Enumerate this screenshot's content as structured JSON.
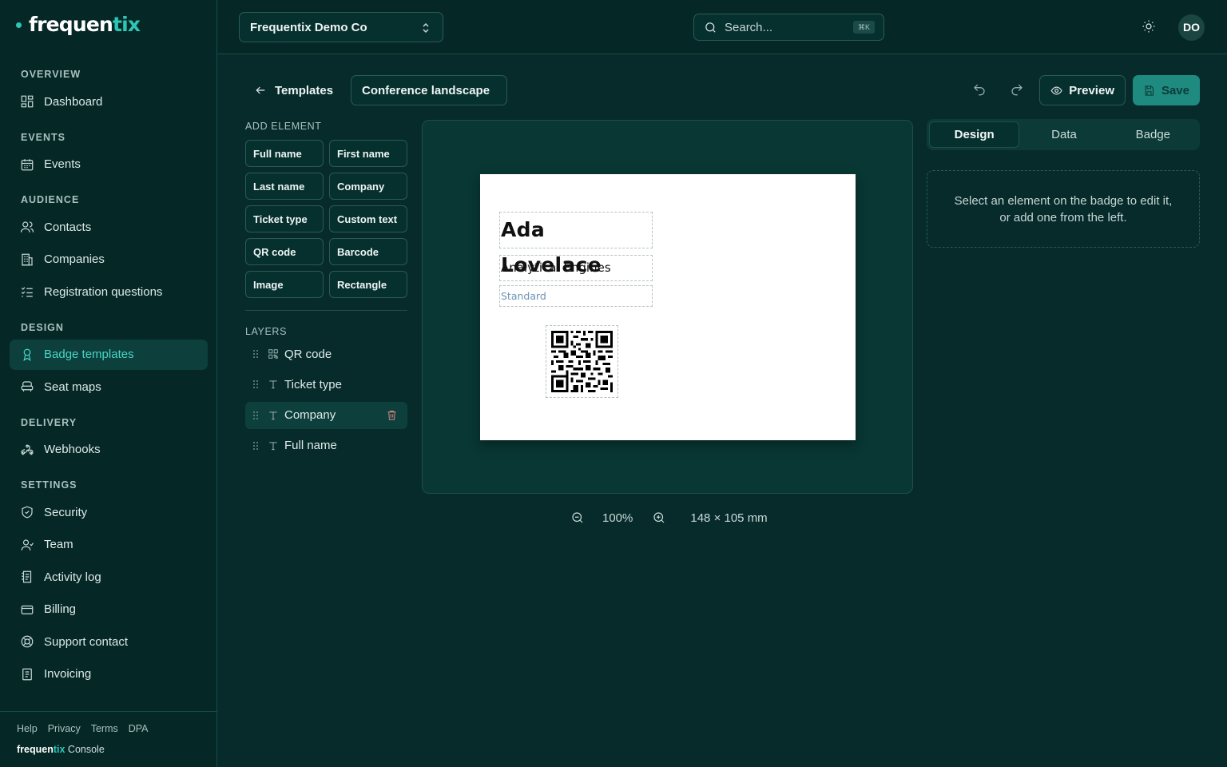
{
  "brand": {
    "name_main": "frequen",
    "name_accent": "tix",
    "accent_color": "#2cc6b5"
  },
  "sidebar": {
    "sections": [
      {
        "title": "OVERVIEW",
        "items": [
          {
            "label": "Dashboard",
            "icon": "dashboard-icon"
          }
        ]
      },
      {
        "title": "EVENTS",
        "items": [
          {
            "label": "Events",
            "icon": "calendar-icon"
          }
        ]
      },
      {
        "title": "AUDIENCE",
        "items": [
          {
            "label": "Contacts",
            "icon": "users-icon"
          },
          {
            "label": "Companies",
            "icon": "building-icon"
          },
          {
            "label": "Registration questions",
            "icon": "list-check-icon"
          }
        ]
      },
      {
        "title": "DESIGN",
        "items": [
          {
            "label": "Badge templates",
            "icon": "badge-icon",
            "active": true
          },
          {
            "label": "Seat maps",
            "icon": "seat-icon"
          }
        ]
      },
      {
        "title": "DELIVERY",
        "items": [
          {
            "label": "Webhooks",
            "icon": "webhook-icon"
          }
        ]
      },
      {
        "title": "SETTINGS",
        "items": [
          {
            "label": "Security",
            "icon": "shield-icon"
          },
          {
            "label": "Team",
            "icon": "team-icon"
          },
          {
            "label": "Activity log",
            "icon": "activity-log-icon"
          },
          {
            "label": "Billing",
            "icon": "credit-card-icon"
          },
          {
            "label": "Support contact",
            "icon": "lifebuoy-icon"
          },
          {
            "label": "Invoicing",
            "icon": "invoice-icon"
          }
        ]
      }
    ],
    "footer_links": [
      "Help",
      "Privacy",
      "Terms",
      "DPA"
    ],
    "footer_brand": {
      "main": "frequen",
      "accent": "tix",
      "suffix": "Console"
    }
  },
  "topbar": {
    "org": "Frequentix Demo Co",
    "search_placeholder": "Search...",
    "shortcut": "⌘K",
    "avatar_initials": "DO"
  },
  "editor": {
    "back_label": "Templates",
    "template_name": "Conference landscape",
    "preview_label": "Preview",
    "save_label": "Save",
    "add_element_title": "ADD ELEMENT",
    "elements": [
      "Full name",
      "First name",
      "Last name",
      "Company",
      "Ticket type",
      "Custom text",
      "QR code",
      "Barcode",
      "Image",
      "Rectangle"
    ],
    "layers_title": "LAYERS",
    "layers": [
      {
        "label": "QR code",
        "type": "qr"
      },
      {
        "label": "Ticket type",
        "type": "text"
      },
      {
        "label": "Company",
        "type": "text",
        "selected": true
      },
      {
        "label": "Full name",
        "type": "text"
      }
    ]
  },
  "badge": {
    "full_name": "Ada Lovelace",
    "company": "Analytical Engines",
    "ticket_type": "Standard"
  },
  "zoom": {
    "level": "100%",
    "dimensions": "148 × 105 mm"
  },
  "right_panel": {
    "tabs": [
      {
        "label": "Design",
        "active": true
      },
      {
        "label": "Data"
      },
      {
        "label": "Badge"
      }
    ],
    "hint_line1": "Select an element on the badge to edit it,",
    "hint_line2": "or add one from the left."
  }
}
